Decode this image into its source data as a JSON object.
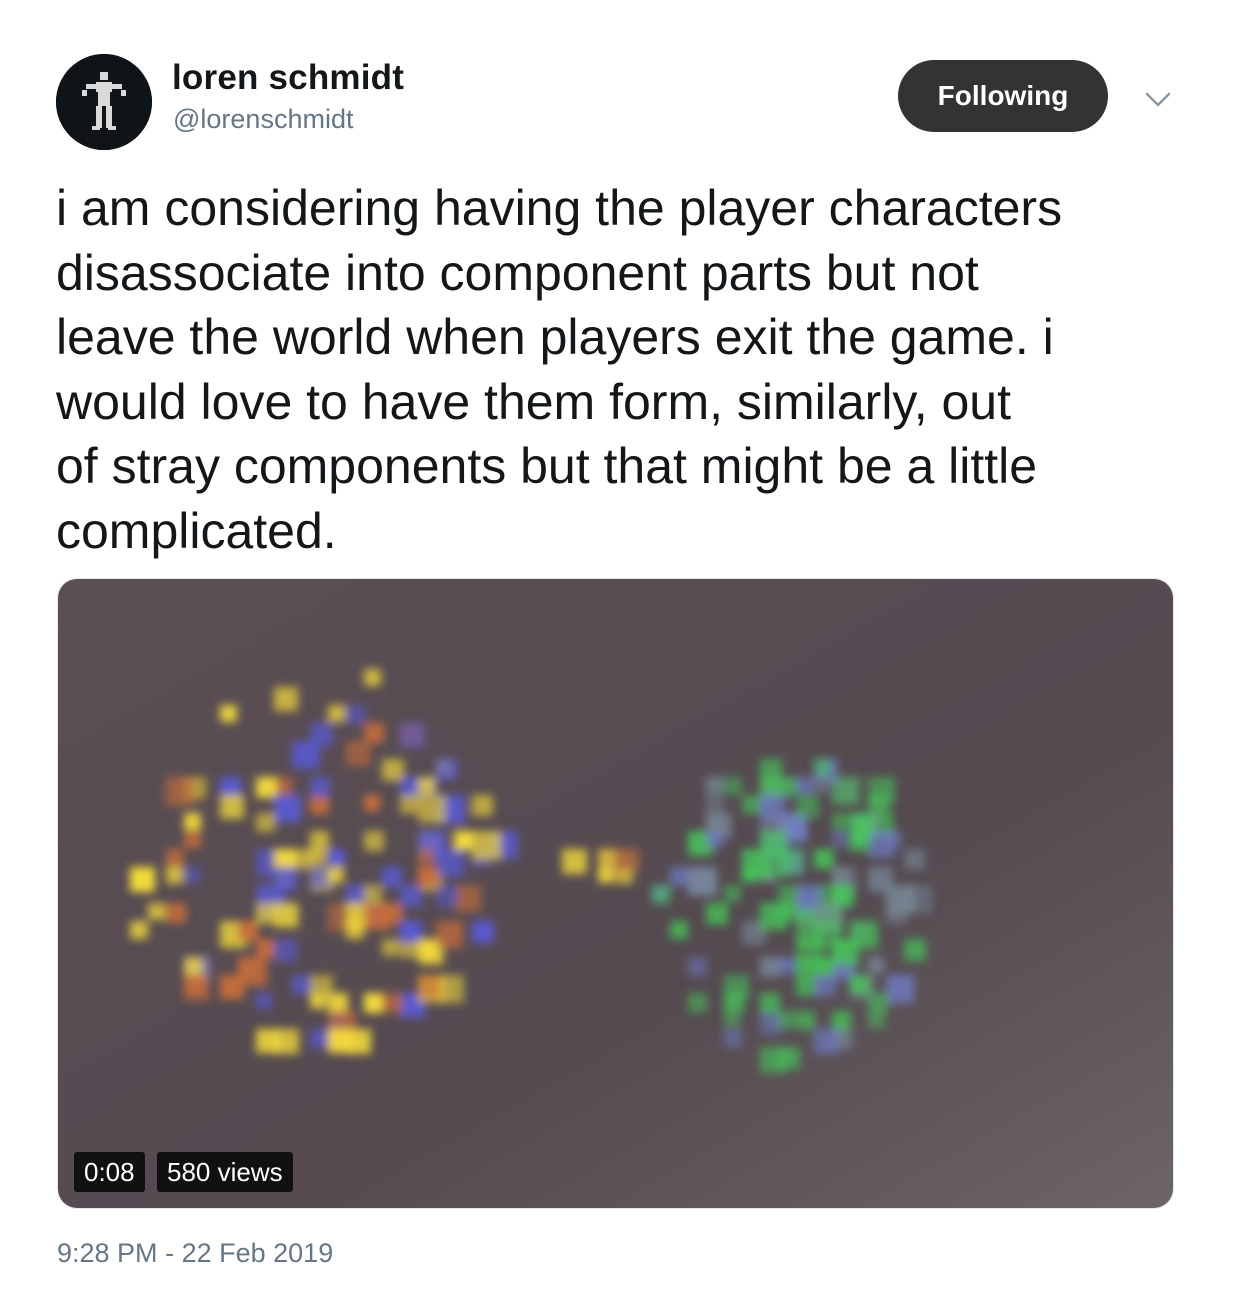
{
  "author": {
    "display_name": "loren schmidt",
    "handle": "@lorenschmidt",
    "avatar_icon": "pixel-figure-icon"
  },
  "follow_button": {
    "label": "Following"
  },
  "menu": {
    "icon": "chevron-down-icon"
  },
  "tweet": {
    "text": "i am considering having the player characters\ndisassociate into component parts but not\nleave the world when players exit the game. i\nwould love to have them form, similarly, out\nof stray components but that might be a little\ncomplicated."
  },
  "video": {
    "duration": "0:08",
    "views": "580 views"
  },
  "meta": {
    "time": "9:28 PM",
    "separator": "-",
    "date": "22 Feb 2019"
  },
  "colors": {
    "text": "#14171a",
    "secondary": "#657786",
    "button_bg": "#333333",
    "video_bg": "#5a4f55",
    "pixel_yellow": "#f5dc3c",
    "pixel_blue": "#5a5ad2",
    "pixel_green": "#46c85a"
  }
}
